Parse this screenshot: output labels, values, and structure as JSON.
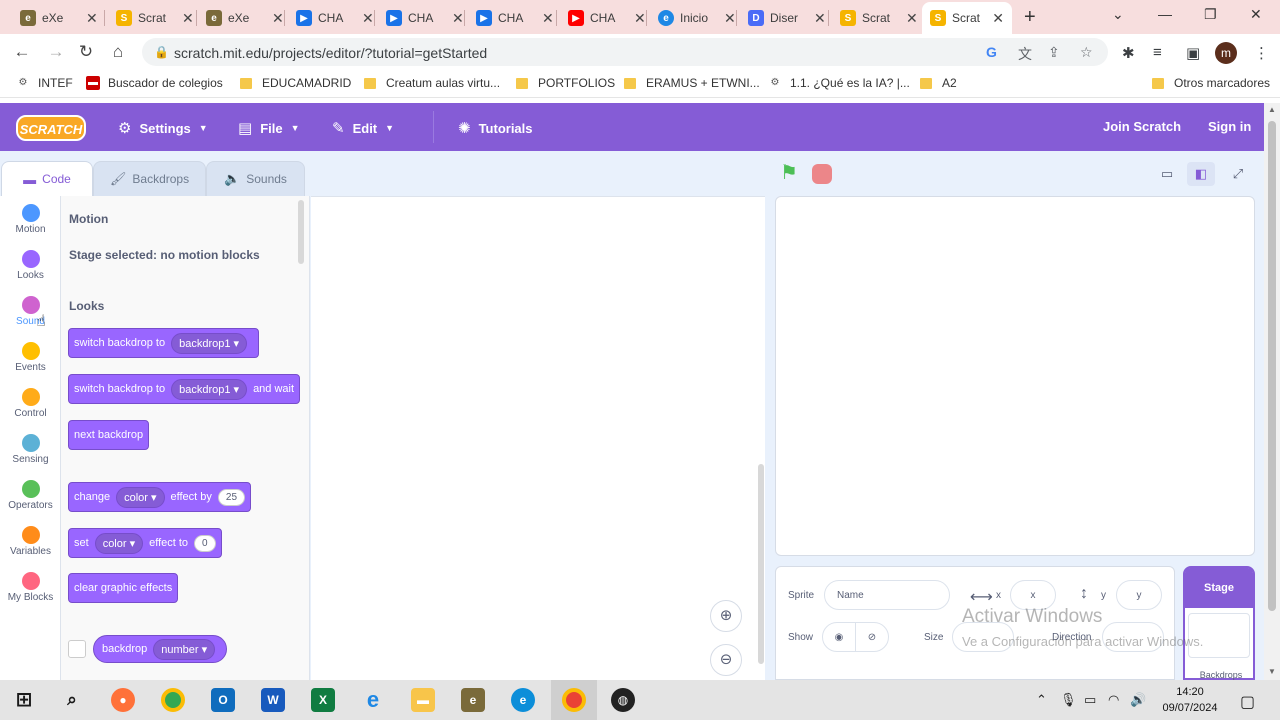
{
  "browser": {
    "tabs": [
      {
        "title": "eXe",
        "color": "#7a6a3a"
      },
      {
        "title": "eXe",
        "color": "#7a6a3a"
      },
      {
        "title": "Scrat",
        "color": "#f5b400"
      },
      {
        "title": "CHA",
        "color": "#1a73e8"
      },
      {
        "title": "CHA",
        "color": "#1a73e8"
      },
      {
        "title": "CHA",
        "color": "#1a73e8"
      },
      {
        "title": "CHA",
        "color": "#ff0000"
      },
      {
        "title": "Inicio",
        "color": "#1e88e5"
      },
      {
        "title": "Diser",
        "color": "#4a6cf7"
      },
      {
        "title": "Scrat",
        "color": "#f5b400"
      },
      {
        "title": "Scrat",
        "color": "#f5b400"
      }
    ],
    "url": "scratch.mit.edu/projects/editor/?tutorial=getStarted",
    "profile_initial": "m"
  },
  "bookmarks": [
    {
      "label": "INTEF",
      "type": "site"
    },
    {
      "label": "Buscador de colegios",
      "type": "site"
    },
    {
      "label": "EDUCAMADRID",
      "type": "folder"
    },
    {
      "label": "Creatum aulas virtu...",
      "type": "folder"
    },
    {
      "label": "PORTFOLIOS",
      "type": "folder"
    },
    {
      "label": "ERAMUS + ETWNI...",
      "type": "folder"
    },
    {
      "label": "1.1. ¿Qué es la IA? |...",
      "type": "site"
    },
    {
      "label": "A2",
      "type": "folder"
    },
    {
      "label": "Otros marcadores",
      "type": "folder"
    }
  ],
  "scratch_header": {
    "logo": "SCRATCH",
    "settings": "Settings",
    "file": "File",
    "edit": "Edit",
    "tutorials": "Tutorials",
    "join": "Join Scratch",
    "signin": "Sign in"
  },
  "editor_tabs": {
    "code": "Code",
    "backdrops": "Backdrops",
    "sounds": "Sounds"
  },
  "categories": [
    {
      "label": "Motion",
      "color": "#4c97ff"
    },
    {
      "label": "Looks",
      "color": "#9966ff"
    },
    {
      "label": "Sound",
      "color": "#cf63cf"
    },
    {
      "label": "Events",
      "color": "#ffbf00"
    },
    {
      "label": "Control",
      "color": "#ffab19"
    },
    {
      "label": "Sensing",
      "color": "#5cb1d6"
    },
    {
      "label": "Operators",
      "color": "#59c059"
    },
    {
      "label": "Variables",
      "color": "#ff8c1a"
    },
    {
      "label": "My Blocks",
      "color": "#ff6680"
    }
  ],
  "palette": {
    "motion_heading": "Motion",
    "motion_note": "Stage selected: no motion blocks",
    "looks_heading": "Looks",
    "blocks": {
      "switch_backdrop": {
        "text": "switch backdrop to",
        "value": "backdrop1"
      },
      "switch_backdrop_wait": {
        "text": "switch backdrop to",
        "value": "backdrop1",
        "suffix": "and wait"
      },
      "next_backdrop": {
        "text": "next backdrop"
      },
      "change_effect": {
        "text": "change",
        "effect": "color",
        "mid": "effect by",
        "value": "25"
      },
      "set_effect": {
        "text": "set",
        "effect": "color",
        "mid": "effect to",
        "value": "0"
      },
      "clear_effects": {
        "text": "clear graphic effects"
      },
      "backdrop_reporter": {
        "text": "backdrop",
        "value": "number"
      }
    }
  },
  "sprite_info": {
    "sprite_label": "Sprite",
    "name_placeholder": "Name",
    "x_label": "x",
    "x_placeholder": "x",
    "y_label": "y",
    "y_placeholder": "y",
    "show_label": "Show",
    "size_label": "Size",
    "direction_label": "Direction"
  },
  "stage_pane": {
    "title": "Stage",
    "backdrops_label": "Backdrops"
  },
  "watermark": {
    "line1": "Activar Windows",
    "line2": "Ve a Configuración para activar Windows."
  },
  "clock": {
    "time": "14:20",
    "date": "09/07/2024"
  }
}
